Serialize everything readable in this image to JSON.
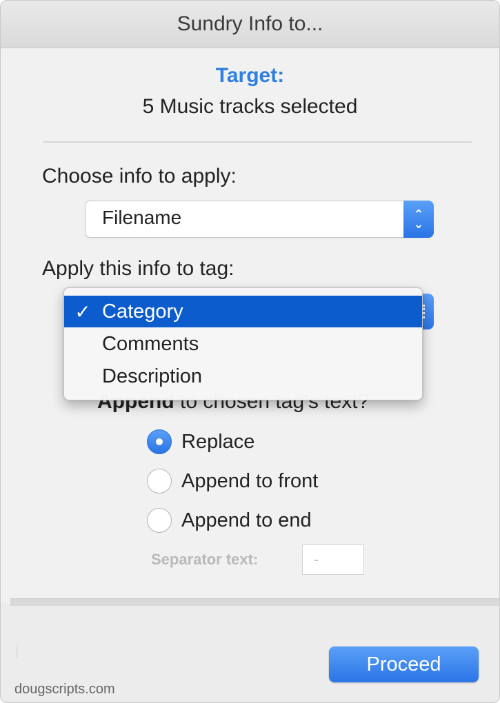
{
  "window": {
    "title": "Sundry Info to..."
  },
  "target": {
    "label": "Target:",
    "value": "5 Music tracks selected"
  },
  "choose_info": {
    "label": "Choose info to apply:",
    "selected": "Filename"
  },
  "apply_tag": {
    "label": "Apply this info to tag:",
    "menu": {
      "items": [
        {
          "label": "Category",
          "checked": true
        },
        {
          "label": "Comments",
          "checked": false
        },
        {
          "label": "Description",
          "checked": false
        }
      ],
      "check_glyph": "✓"
    }
  },
  "mode": {
    "heading_bold": "Append",
    "heading_rest": " to chosen tag's text?",
    "options": [
      {
        "label": "Replace",
        "selected": true
      },
      {
        "label": "Append to front",
        "selected": false
      },
      {
        "label": "Append to end",
        "selected": false
      }
    ]
  },
  "separator": {
    "label": "Separator text:",
    "value": "-"
  },
  "actions": {
    "proceed_label": "Proceed"
  },
  "footer": {
    "text": "dougscripts.com"
  },
  "colors": {
    "accent": "#2a74e6",
    "target_label": "#2f7fe0",
    "menu_highlight": "#0c5ccd"
  }
}
